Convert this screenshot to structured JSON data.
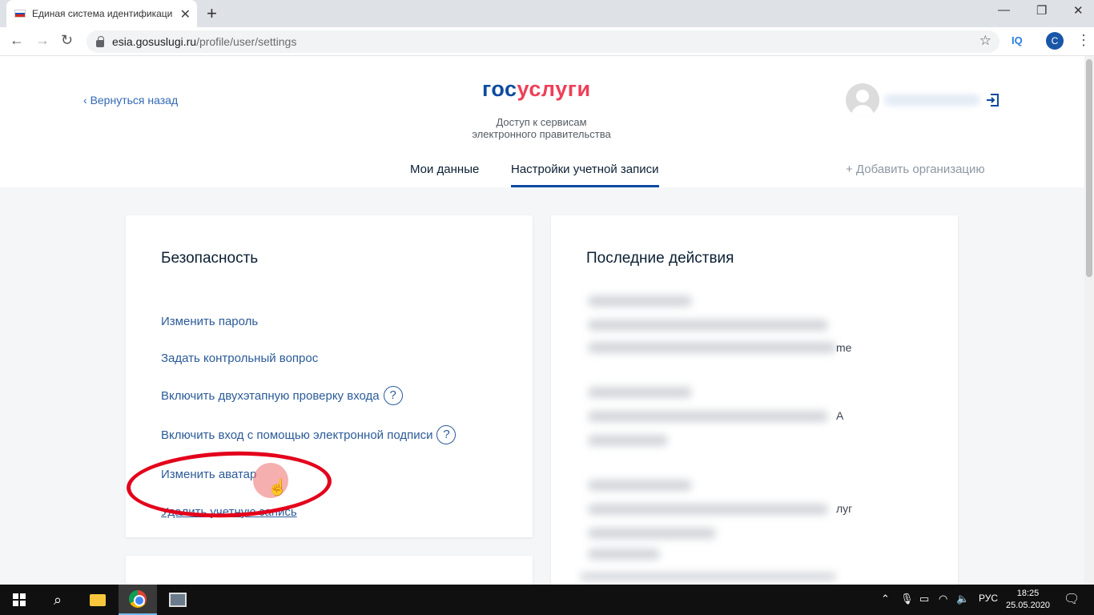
{
  "browser": {
    "tab_title": "Единая система идентификаци",
    "tab_close": "✕",
    "new_tab": "+",
    "url_host": "esia.gosuslugi.ru",
    "url_path": "/profile/user/settings",
    "minimize": "—",
    "maximize": "❐",
    "close": "✕",
    "extension_label": "IQ",
    "profile_initial": "C"
  },
  "header": {
    "back_link": "Вернуться назад",
    "logo_gos": "гос",
    "logo_uslugi": "услуги",
    "subtitle_line1": "Доступ к сервисам",
    "subtitle_line2": "электронного правительства",
    "tabs": [
      {
        "label": "Мои данные",
        "active": false
      },
      {
        "label": "Настройки учетной записи",
        "active": true
      }
    ],
    "add_org": "+ Добавить организацию"
  },
  "security": {
    "title": "Безопасность",
    "links": [
      {
        "label": "Изменить пароль",
        "help": false
      },
      {
        "label": "Задать контрольный вопрос",
        "help": false
      },
      {
        "label": "Включить двухэтапную проверку входа",
        "help": true
      },
      {
        "label": "Включить вход с помощью электронной подписи",
        "help": true
      },
      {
        "label": "Изменить аватар",
        "help": false
      },
      {
        "label": "Удалить учетную запись",
        "help": false
      }
    ],
    "help_glyph": "?"
  },
  "actions": {
    "title": "Последние действия",
    "visible_fragments": [
      "me",
      "A",
      "луг"
    ]
  },
  "taskbar": {
    "language": "РУС",
    "time": "18:25",
    "date": "25.05.2020"
  },
  "colors": {
    "logo_blue": "#0d4b9f",
    "logo_red": "#ee3f58",
    "link": "#2b5b98",
    "highlight": "#e3001b"
  }
}
